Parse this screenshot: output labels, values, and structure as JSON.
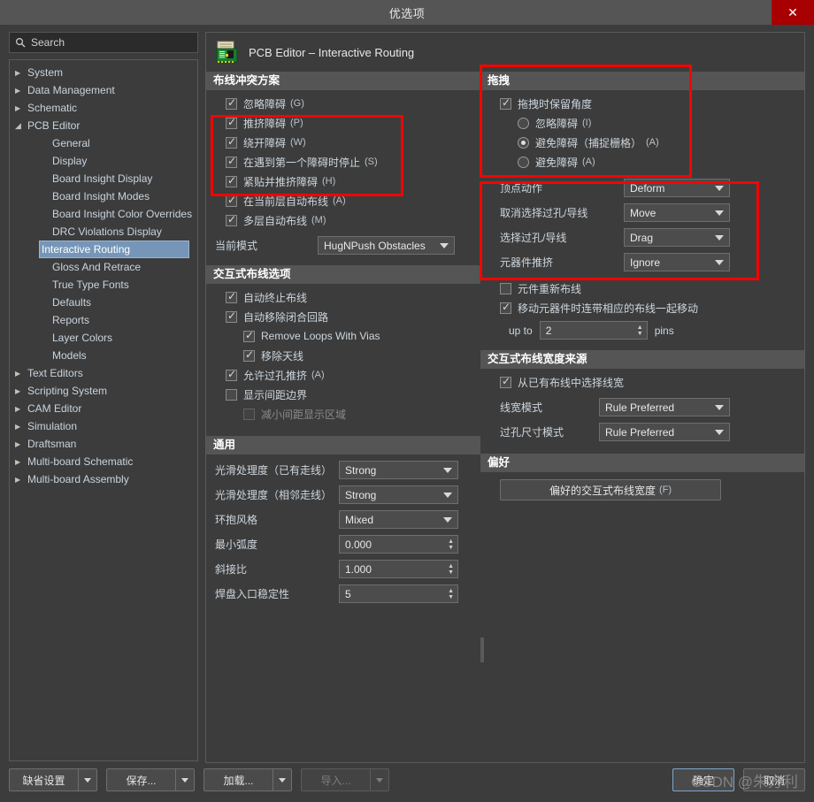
{
  "window": {
    "title": "优选项",
    "close_label": "✕"
  },
  "search": {
    "placeholder": "Search",
    "value": "Search",
    "icon": "search-icon"
  },
  "sidebar": {
    "items": [
      {
        "label": "System",
        "level": 1,
        "state": "collapsed",
        "selected": false
      },
      {
        "label": "Data Management",
        "level": 1,
        "state": "collapsed",
        "selected": false
      },
      {
        "label": "Schematic",
        "level": 1,
        "state": "collapsed",
        "selected": false
      },
      {
        "label": "PCB Editor",
        "level": 1,
        "state": "expanded",
        "selected": false
      },
      {
        "label": "General",
        "level": 2,
        "state": "none",
        "selected": false
      },
      {
        "label": "Display",
        "level": 2,
        "state": "none",
        "selected": false
      },
      {
        "label": "Board Insight Display",
        "level": 2,
        "state": "none",
        "selected": false
      },
      {
        "label": "Board Insight Modes",
        "level": 2,
        "state": "none",
        "selected": false
      },
      {
        "label": "Board Insight Color Overrides",
        "level": 2,
        "state": "none",
        "selected": false
      },
      {
        "label": "DRC Violations Display",
        "level": 2,
        "state": "none",
        "selected": false
      },
      {
        "label": "Interactive Routing",
        "level": 2,
        "state": "none",
        "selected": true
      },
      {
        "label": "Gloss And Retrace",
        "level": 2,
        "state": "none",
        "selected": false
      },
      {
        "label": "True Type Fonts",
        "level": 2,
        "state": "none",
        "selected": false
      },
      {
        "label": "Defaults",
        "level": 2,
        "state": "none",
        "selected": false
      },
      {
        "label": "Reports",
        "level": 2,
        "state": "none",
        "selected": false
      },
      {
        "label": "Layer Colors",
        "level": 2,
        "state": "none",
        "selected": false
      },
      {
        "label": "Models",
        "level": 2,
        "state": "none",
        "selected": false
      },
      {
        "label": "Text Editors",
        "level": 1,
        "state": "collapsed",
        "selected": false
      },
      {
        "label": "Scripting System",
        "level": 1,
        "state": "collapsed",
        "selected": false
      },
      {
        "label": "CAM Editor",
        "level": 1,
        "state": "collapsed",
        "selected": false
      },
      {
        "label": "Simulation",
        "level": 1,
        "state": "collapsed",
        "selected": false
      },
      {
        "label": "Draftsman",
        "level": 1,
        "state": "collapsed",
        "selected": false
      },
      {
        "label": "Multi-board Schematic",
        "level": 1,
        "state": "collapsed",
        "selected": false
      },
      {
        "label": "Multi-board Assembly",
        "level": 1,
        "state": "collapsed",
        "selected": false
      }
    ]
  },
  "page": {
    "header_title": "PCB Editor – Interactive Routing",
    "header_icon": "pcb-board-icon"
  },
  "routing_conflict": {
    "header": "布线冲突方案",
    "options": [
      {
        "label": "忽略障碍",
        "hotkey": "(G)",
        "checked": true
      },
      {
        "label": "推挤障碍",
        "hotkey": "(P)",
        "checked": true
      },
      {
        "label": "绕开障碍",
        "hotkey": "(W)",
        "checked": true
      },
      {
        "label": "在遇到第一个障碍时停止",
        "hotkey": "(S)",
        "checked": true
      },
      {
        "label": "紧贴并推挤障碍",
        "hotkey": "(H)",
        "checked": true
      },
      {
        "label": "在当前层自动布线",
        "hotkey": "(A)",
        "checked": true
      },
      {
        "label": "多层自动布线",
        "hotkey": "(M)",
        "checked": true
      }
    ],
    "current_mode_label": "当前模式",
    "current_mode_value": "HugNPush Obstacles"
  },
  "interactive_routing_options": {
    "header": "交互式布线选项",
    "options": [
      {
        "label": "自动终止布线",
        "hotkey": "",
        "checked": true,
        "indent": 1,
        "disabled": false
      },
      {
        "label": "自动移除闭合回路",
        "hotkey": "",
        "checked": true,
        "indent": 1,
        "disabled": false
      },
      {
        "label": "Remove Loops With Vias",
        "hotkey": "",
        "checked": true,
        "indent": 2,
        "disabled": false
      },
      {
        "label": "移除天线",
        "hotkey": "",
        "checked": true,
        "indent": 2,
        "disabled": false
      },
      {
        "label": "允许过孔推挤",
        "hotkey": "(A)",
        "checked": true,
        "indent": 1,
        "disabled": false
      },
      {
        "label": "显示间距边界",
        "hotkey": "",
        "checked": false,
        "indent": 1,
        "disabled": false
      },
      {
        "label": "减小间距显示区域",
        "hotkey": "",
        "checked": false,
        "indent": 2,
        "disabled": true
      }
    ]
  },
  "general": {
    "header": "通用",
    "fields": [
      {
        "label": "光滑处理度（已有走线）",
        "type": "combo",
        "value": "Strong"
      },
      {
        "label": "光滑处理度（相邻走线）",
        "type": "combo",
        "value": "Strong"
      },
      {
        "label": "环抱风格",
        "type": "combo",
        "value": "Mixed"
      },
      {
        "label": "最小弧度",
        "type": "spin",
        "value": "0.000"
      },
      {
        "label": "斜接比",
        "type": "spin",
        "value": "1.000"
      },
      {
        "label": "焊盘入口稳定性",
        "type": "spin",
        "value": "5"
      }
    ]
  },
  "drag": {
    "header": "拖拽",
    "preserve_angle": {
      "label": "拖拽时保留角度",
      "checked": true
    },
    "radios": [
      {
        "label": "忽略障碍",
        "hotkey": "(I)",
        "selected": false
      },
      {
        "label": "避免障碍（捕捉栅格）",
        "hotkey": "(A)",
        "selected": true
      },
      {
        "label": "避免障碍",
        "hotkey": "(A)",
        "selected": false
      }
    ],
    "fields": [
      {
        "label": "顶点动作",
        "value": "Deform"
      },
      {
        "label": "取消选择过孔/导线",
        "value": "Move"
      },
      {
        "label": "选择过孔/导线",
        "value": "Drag"
      },
      {
        "label": "元器件推挤",
        "value": "Ignore"
      }
    ],
    "component_rerout": {
      "label": "元件重新布线",
      "checked": false
    },
    "move_with_traces": {
      "label": "移动元器件时连带相应的布线一起移动",
      "checked": true
    },
    "up_to_prefix": "up to",
    "up_to_value": "2",
    "up_to_suffix": "pins"
  },
  "width_source": {
    "header": "交互式布线宽度来源",
    "pick_from_existing": {
      "label": "从已有布线中选择线宽",
      "checked": true
    },
    "fields": [
      {
        "label": "线宽模式",
        "value": "Rule Preferred"
      },
      {
        "label": "过孔尺寸模式",
        "value": "Rule Preferred"
      }
    ]
  },
  "favorites": {
    "header": "偏好",
    "button_label": "偏好的交互式布线宽度",
    "button_hotkey": "(F)"
  },
  "bottom_bar": {
    "buttons": [
      {
        "label": "缺省设置",
        "disabled": false
      },
      {
        "label": "保存...",
        "disabled": false
      },
      {
        "label": "加载...",
        "disabled": false
      },
      {
        "label": "导入...",
        "disabled": true
      }
    ],
    "ok_label": "确定",
    "cancel_label": "取消"
  },
  "watermark": {
    "text": "CSDN @朱方利"
  },
  "colors": {
    "accent_red": "#ff0000",
    "selection_blue": "#7596b8",
    "titlebar": "#555555",
    "close_red": "#a80000",
    "panel_bg": "#3c3c3c",
    "group_header_bg": "#555555"
  }
}
